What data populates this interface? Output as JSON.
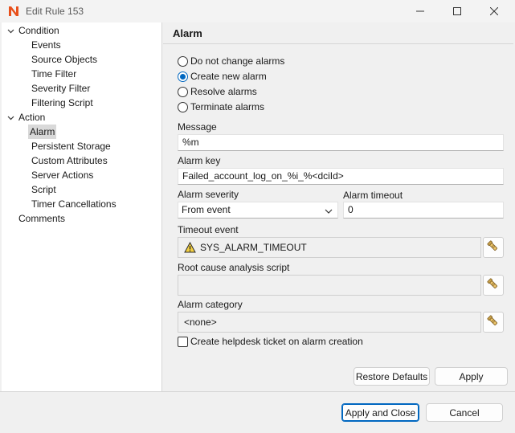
{
  "window": {
    "title": "Edit Rule 153",
    "icons": {
      "app": "netxms-logo-icon",
      "minimize": "minimize-icon",
      "maximize": "maximize-icon",
      "close": "close-icon"
    }
  },
  "tree": {
    "items": [
      {
        "label": "Condition",
        "level": 0,
        "expanded": true,
        "selected": false
      },
      {
        "label": "Events",
        "level": 1,
        "selected": false
      },
      {
        "label": "Source Objects",
        "level": 1,
        "selected": false
      },
      {
        "label": "Time Filter",
        "level": 1,
        "selected": false
      },
      {
        "label": "Severity Filter",
        "level": 1,
        "selected": false
      },
      {
        "label": "Filtering Script",
        "level": 1,
        "selected": false
      },
      {
        "label": "Action",
        "level": 0,
        "expanded": true,
        "selected": false
      },
      {
        "label": "Alarm",
        "level": 1,
        "selected": true
      },
      {
        "label": "Persistent Storage",
        "level": 1,
        "selected": false
      },
      {
        "label": "Custom Attributes",
        "level": 1,
        "selected": false
      },
      {
        "label": "Server Actions",
        "level": 1,
        "selected": false
      },
      {
        "label": "Script",
        "level": 1,
        "selected": false
      },
      {
        "label": "Timer Cancellations",
        "level": 1,
        "selected": false
      },
      {
        "label": "Comments",
        "level": 0,
        "selected": false
      }
    ]
  },
  "page": {
    "title": "Alarm",
    "radios": [
      {
        "label": "Do not change alarms",
        "checked": false
      },
      {
        "label": "Create new alarm",
        "checked": true
      },
      {
        "label": "Resolve alarms",
        "checked": false
      },
      {
        "label": "Terminate alarms",
        "checked": false
      }
    ],
    "message": {
      "label": "Message",
      "value": "%m"
    },
    "alarm_key": {
      "label": "Alarm key",
      "value": "Failed_account_log_on_%i_%<dciId>"
    },
    "severity": {
      "label": "Alarm severity",
      "value": "From event"
    },
    "timeout": {
      "label": "Alarm timeout",
      "value": "0"
    },
    "timeout_event": {
      "label": "Timeout event",
      "value": "SYS_ALARM_TIMEOUT",
      "icon": "warning-icon"
    },
    "root_cause": {
      "label": "Root cause analysis script",
      "value": ""
    },
    "category": {
      "label": "Alarm category",
      "value": "<none>"
    },
    "helpdesk": {
      "label": "Create helpdesk ticket on alarm creation",
      "checked": false
    },
    "restore_defaults": "Restore Defaults",
    "apply": "Apply"
  },
  "footer": {
    "apply_close": "Apply and Close",
    "cancel": "Cancel"
  }
}
